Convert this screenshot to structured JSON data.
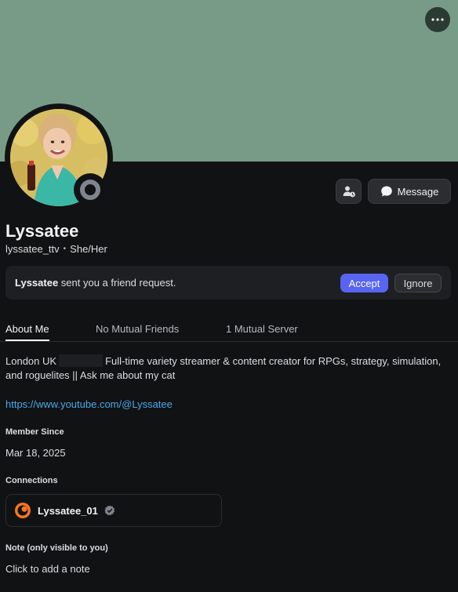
{
  "profile": {
    "display_name": "Lyssatee",
    "username": "lyssatee_ttv",
    "separator": "•",
    "pronouns": "She/Her",
    "status": "offline"
  },
  "actions": {
    "message_label": "Message",
    "add_friend_icon": "friend-request-pending-icon",
    "more_icon": "ellipsis-icon"
  },
  "friend_request": {
    "name": "Lyssatee",
    "text": " sent you a friend request.",
    "accept_label": "Accept",
    "ignore_label": "Ignore"
  },
  "tabs": [
    {
      "label": "About Me",
      "active": true
    },
    {
      "label": "No Mutual Friends",
      "active": false
    },
    {
      "label": "1 Mutual Server",
      "active": false
    }
  ],
  "about": {
    "location": "London UK",
    "bio": "Full-time variety streamer & content creator for RPGs, strategy, simulation, and roguelites || Ask me about my cat",
    "link": "https://www.youtube.com/@Lyssatee"
  },
  "member_since": {
    "label": "Member Since",
    "value": "Mar 18, 2025"
  },
  "connections": {
    "label": "Connections",
    "items": [
      {
        "name": "Lyssatee_01",
        "service_icon": "crunchyroll-icon",
        "verified": true
      }
    ]
  },
  "note": {
    "label": "Note (only visible to you)",
    "placeholder": "Click to add a note"
  },
  "colors": {
    "banner": "#779b87",
    "accent": "#5865f2",
    "link": "#4aa8e8",
    "background": "#111214"
  }
}
